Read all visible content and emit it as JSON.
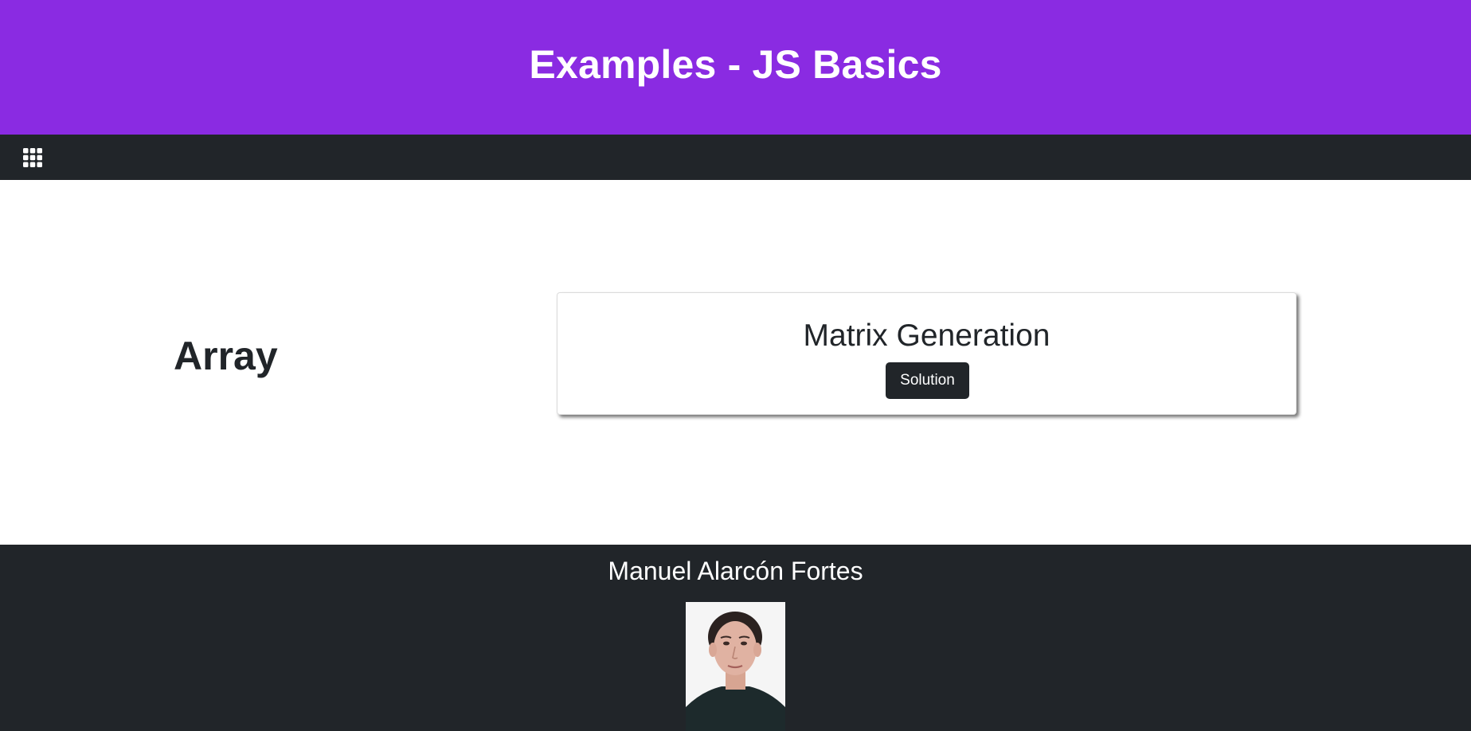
{
  "header": {
    "title": "Examples - JS Basics",
    "background_color": "#8a2be2"
  },
  "navbar": {
    "menu_icon": "grid-icon",
    "background_color": "#212529"
  },
  "main": {
    "section_title": "Array",
    "card": {
      "title": "Matrix Generation",
      "button_label": "Solution"
    }
  },
  "footer": {
    "author_name": "Manuel Alarcón Fortes",
    "photo_icon": "author-photo"
  }
}
